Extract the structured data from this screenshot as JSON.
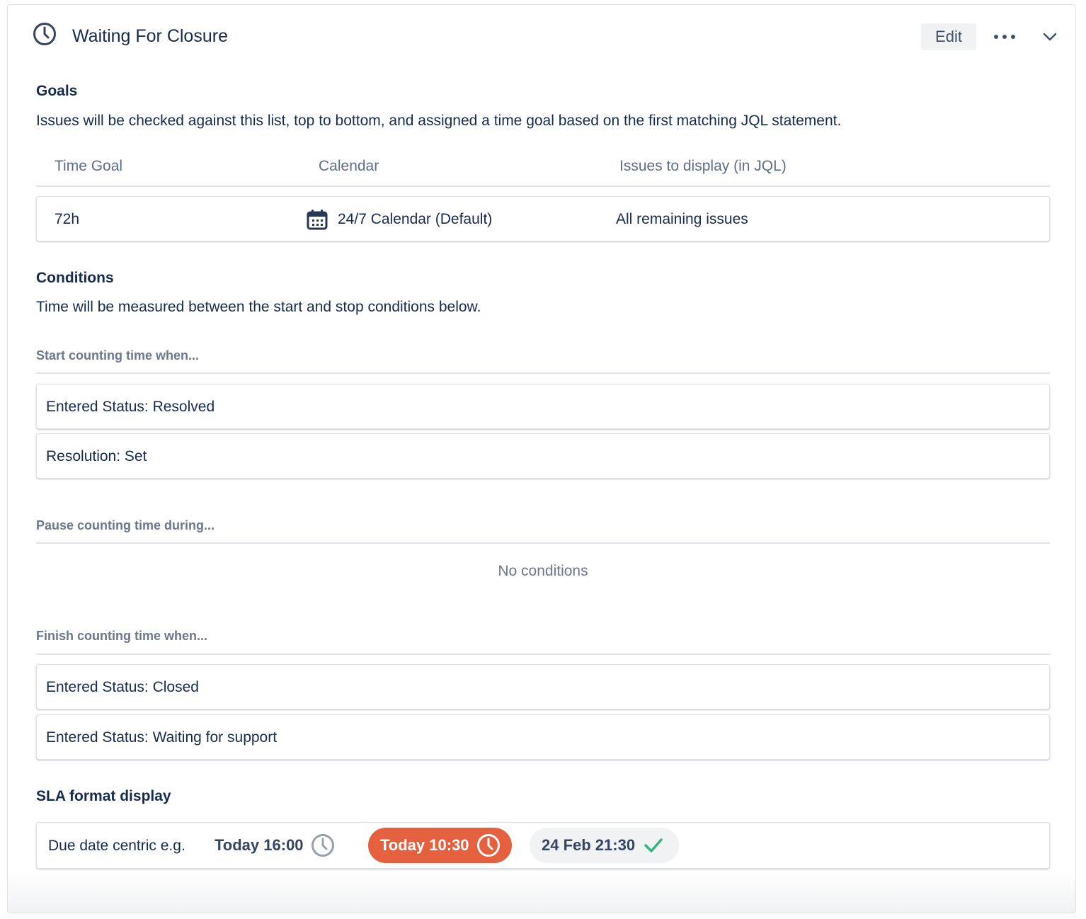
{
  "header": {
    "title": "Waiting For Closure",
    "icon": "clock-icon",
    "edit_label": "Edit",
    "more_icon": "more-icon",
    "collapse_icon": "chevron-down-icon"
  },
  "goals": {
    "heading": "Goals",
    "description": "Issues will be checked against this list, top to bottom, and assigned a time goal based on the first matching JQL statement.",
    "columns": [
      "Time Goal",
      "Calendar",
      "Issues to display (in JQL)"
    ],
    "rows": [
      {
        "time_goal": "72h",
        "calendar": "24/7 Calendar (Default)",
        "issues": "All remaining issues"
      }
    ]
  },
  "conditions": {
    "heading": "Conditions",
    "description": "Time will be measured between the start and stop conditions below.",
    "start": {
      "label": "Start counting time when...",
      "items": [
        "Entered Status: Resolved",
        "Resolution: Set"
      ]
    },
    "pause": {
      "label": "Pause counting time during...",
      "empty_text": "No conditions"
    },
    "finish": {
      "label": "Finish counting time when...",
      "items": [
        "Entered Status: Closed",
        "Entered Status: Waiting for support"
      ]
    }
  },
  "sla_format": {
    "heading": "SLA format display",
    "label": "Due date centric e.g.",
    "examples": [
      {
        "text": "Today 16:00",
        "state": "ongoing",
        "icon": "clock-icon"
      },
      {
        "text": "Today 10:30",
        "state": "breached",
        "icon": "clock-icon",
        "color": "#e5603f"
      },
      {
        "text": "24 Feb 21:30",
        "state": "met",
        "icon": "check-icon",
        "color": "#36b37e"
      }
    ]
  },
  "colors": {
    "text": "#172b4d",
    "subtle": "#6b778c",
    "breached": "#e5603f",
    "met": "#36b37e",
    "border": "#dfe1e6"
  }
}
